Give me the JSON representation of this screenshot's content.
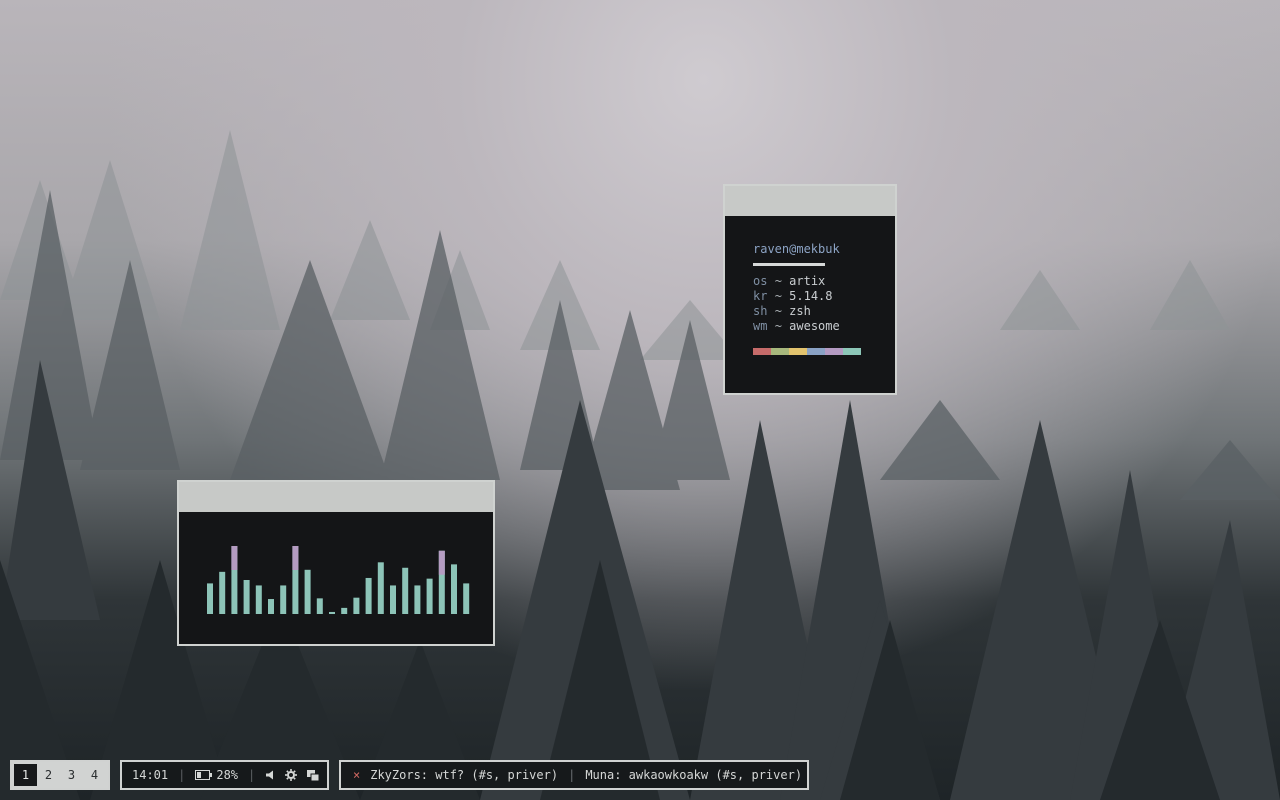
{
  "fetch": {
    "user": "raven@mekbuk",
    "rows": [
      {
        "key": "os",
        "value": "artix"
      },
      {
        "key": "kr",
        "value": "5.14.8"
      },
      {
        "key": "sh",
        "value": "zsh"
      },
      {
        "key": "wm",
        "value": "awesome"
      }
    ],
    "separator": "~",
    "palette": [
      "#c66b6a",
      "#a8b87d",
      "#e2c36e",
      "#8aa2c5",
      "#b49ac2",
      "#8dc7b8"
    ]
  },
  "visualizer": {
    "levels": [
      0.45,
      0.62,
      1.0,
      0.5,
      0.42,
      0.22,
      0.42,
      1.0,
      0.65,
      0.23,
      0.03,
      0.09,
      0.24,
      0.53,
      0.76,
      0.42,
      0.68,
      0.42,
      0.52,
      0.93,
      0.73,
      0.45
    ],
    "bar_color": "#8dc4b8",
    "peak_color": "#b59cc2"
  },
  "taskbar": {
    "tags": [
      "1",
      "2",
      "3",
      "4"
    ],
    "active_tag": "1",
    "clock": "14:01",
    "battery": "28%",
    "notifications": [
      {
        "text": "ZkyZors: wtf? (#s, priver)"
      },
      {
        "text": "Muna: awkaowkoakw (#s, priver)"
      }
    ],
    "dismiss_glyph": "×"
  },
  "icons": [
    "battery-icon",
    "volume-icon",
    "brightness-icon",
    "screens-icon",
    "close-icon"
  ]
}
